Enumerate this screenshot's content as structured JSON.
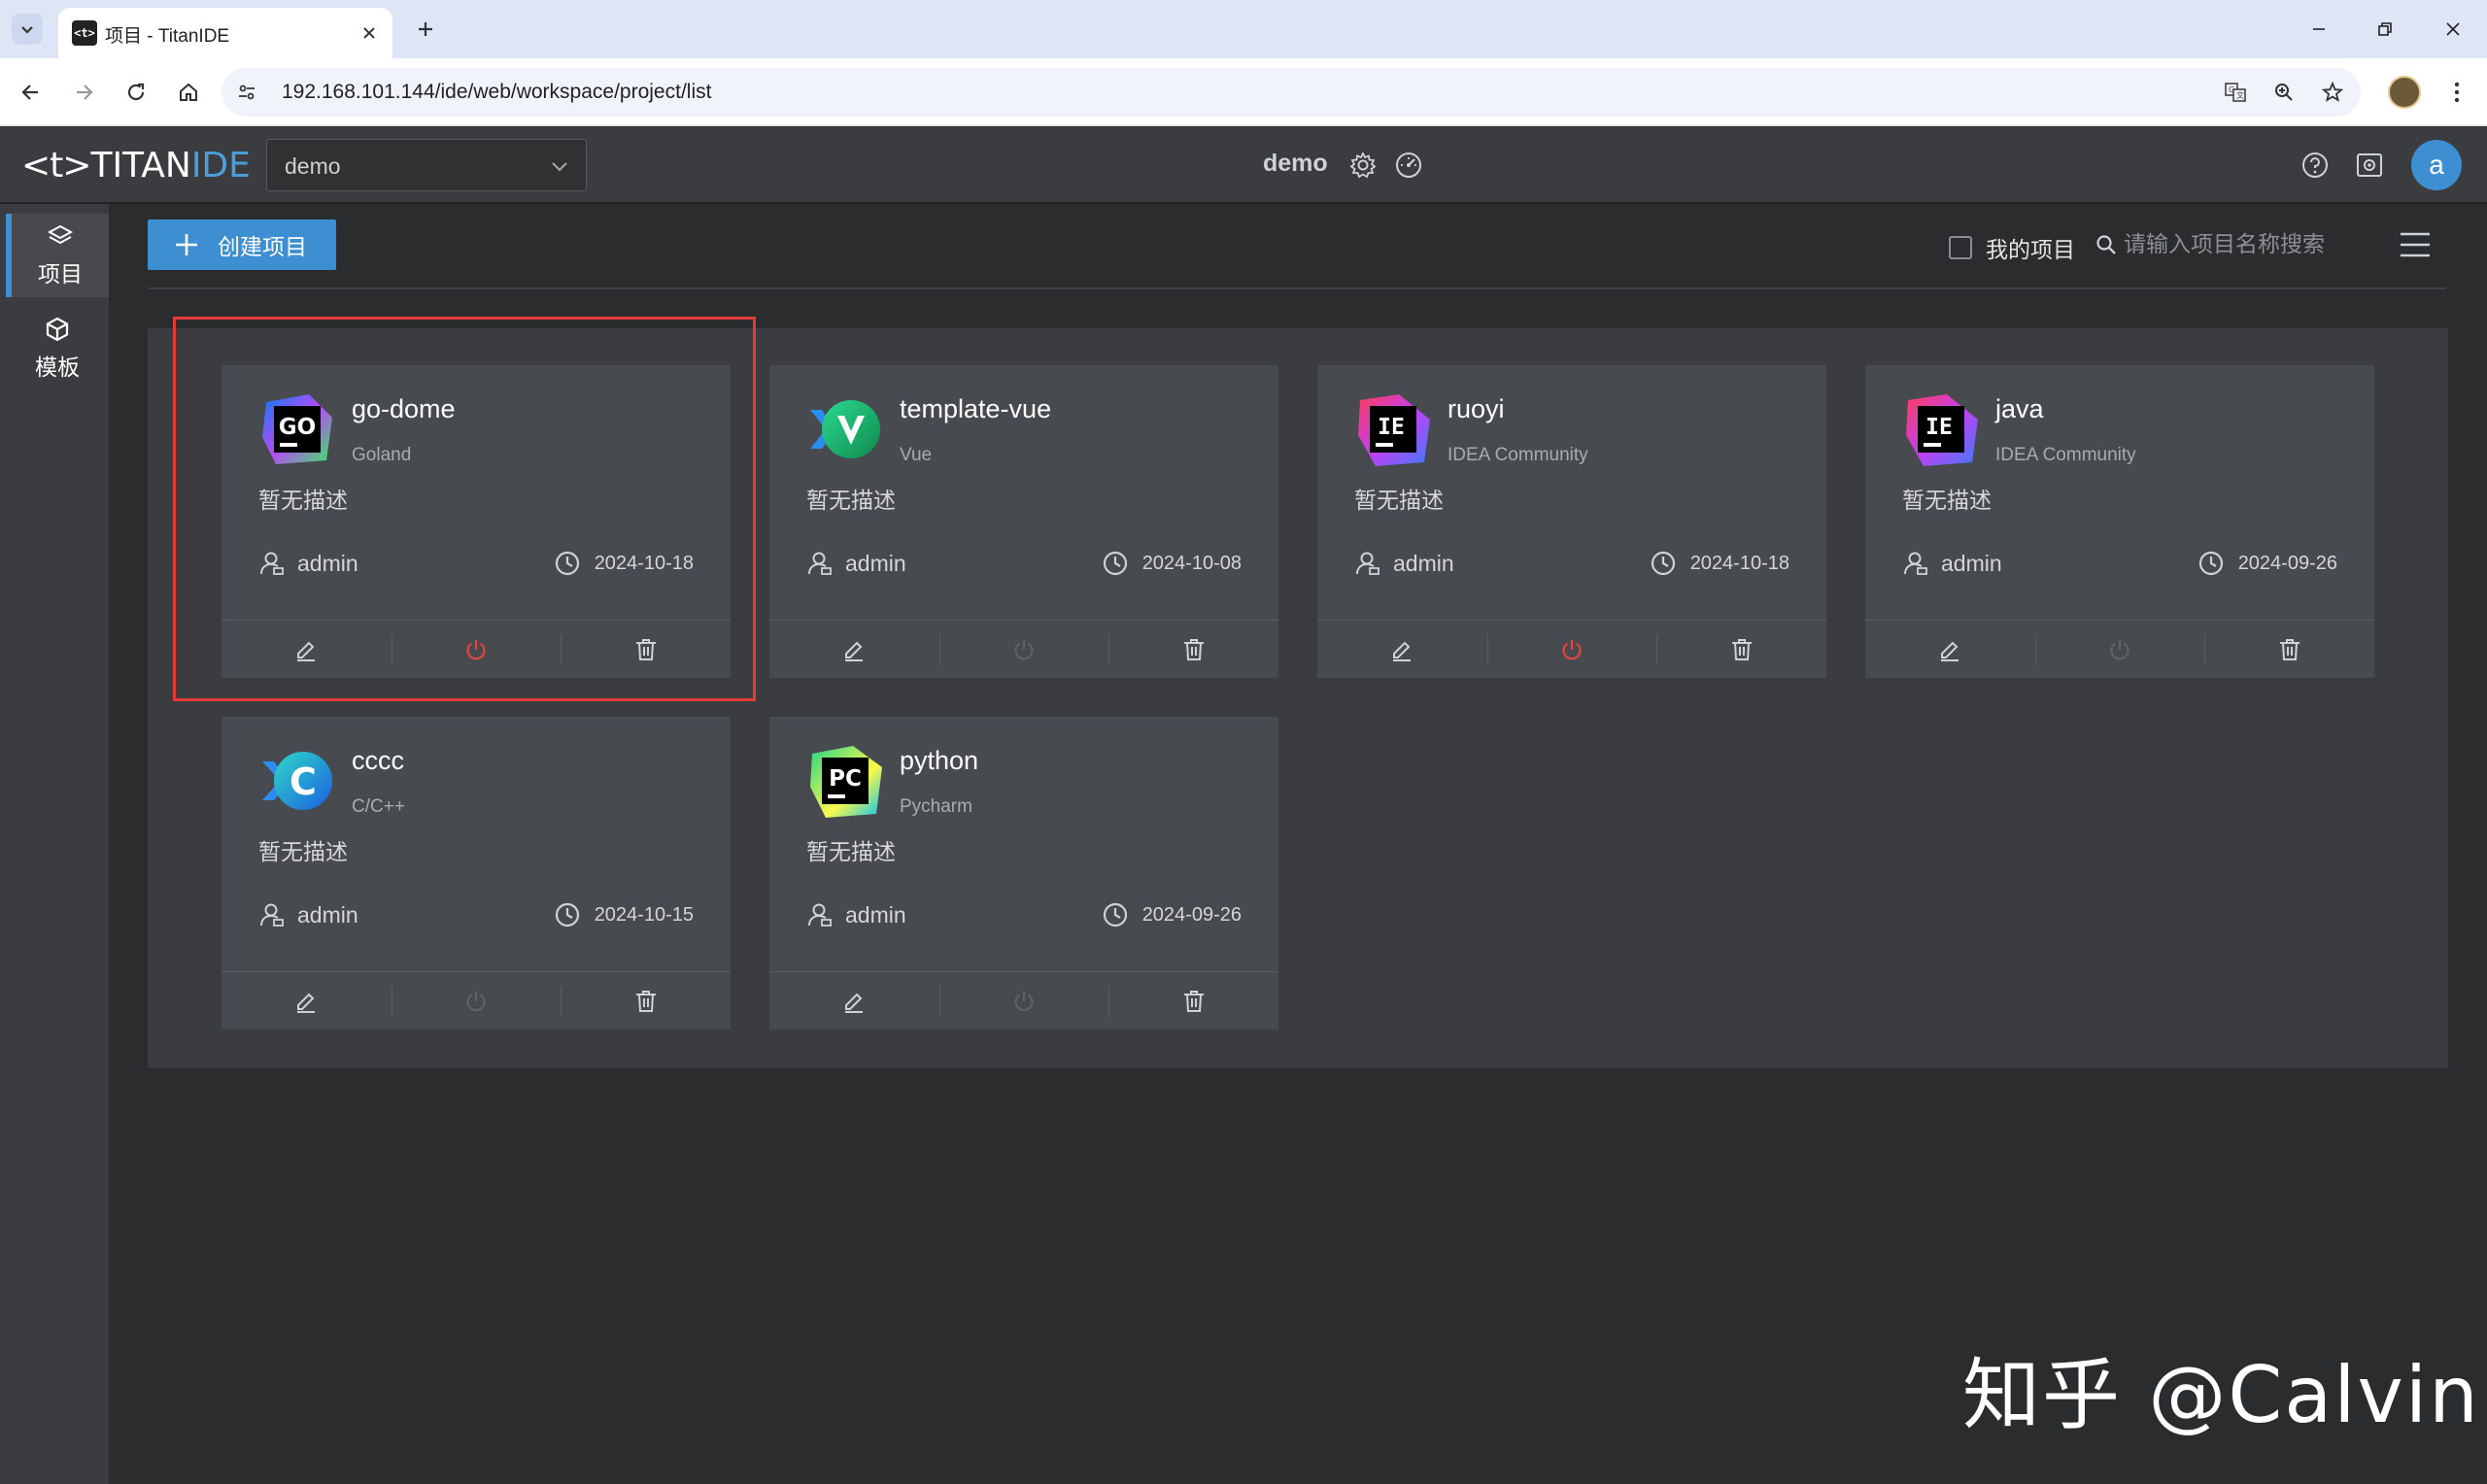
{
  "browser": {
    "tab_title": "项目 - TitanIDE",
    "favicon_text": "<t>",
    "url": "192.168.101.144/ide/web/workspace/project/list"
  },
  "header": {
    "logo_bracket": "<t>",
    "logo_titan": "TITAN",
    "logo_ide": "IDE",
    "workspace_selected": "demo",
    "center_title": "demo",
    "avatar_letter": "a",
    "accent_color": "#3e8ed2"
  },
  "sidebar": {
    "items": [
      {
        "label": "项目",
        "icon": "layers-icon",
        "active": true
      },
      {
        "label": "模板",
        "icon": "cube-icon",
        "active": false
      }
    ]
  },
  "toolbar": {
    "create_label": "创建项目",
    "my_projects_label": "我的项目",
    "search_placeholder": "请输入项目名称搜索"
  },
  "projects": [
    {
      "name": "go-dome",
      "template": "Goland",
      "description": "暂无描述",
      "owner": "admin",
      "date": "2024-10-18",
      "running": true,
      "logo": "goland-icon",
      "logo_text": "GO"
    },
    {
      "name": "template-vue",
      "template": "Vue",
      "description": "暂无描述",
      "owner": "admin",
      "date": "2024-10-08",
      "running": false,
      "logo": "vue-icon",
      "logo_text": "V"
    },
    {
      "name": "ruoyi",
      "template": "IDEA Community",
      "description": "暂无描述",
      "owner": "admin",
      "date": "2024-10-18",
      "running": true,
      "logo": "idea-icon",
      "logo_text": "IE"
    },
    {
      "name": "java",
      "template": "IDEA Community",
      "description": "暂无描述",
      "owner": "admin",
      "date": "2024-09-26",
      "running": false,
      "logo": "idea-icon",
      "logo_text": "IE"
    },
    {
      "name": "cccc",
      "template": "C/C++",
      "description": "暂无描述",
      "owner": "admin",
      "date": "2024-10-15",
      "running": false,
      "logo": "clion-icon",
      "logo_text": "C"
    },
    {
      "name": "python",
      "template": "Pycharm",
      "description": "暂无描述",
      "owner": "admin",
      "date": "2024-09-26",
      "running": false,
      "logo": "pycharm-icon",
      "logo_text": "PC"
    }
  ],
  "watermark": "知乎 @Calvin"
}
